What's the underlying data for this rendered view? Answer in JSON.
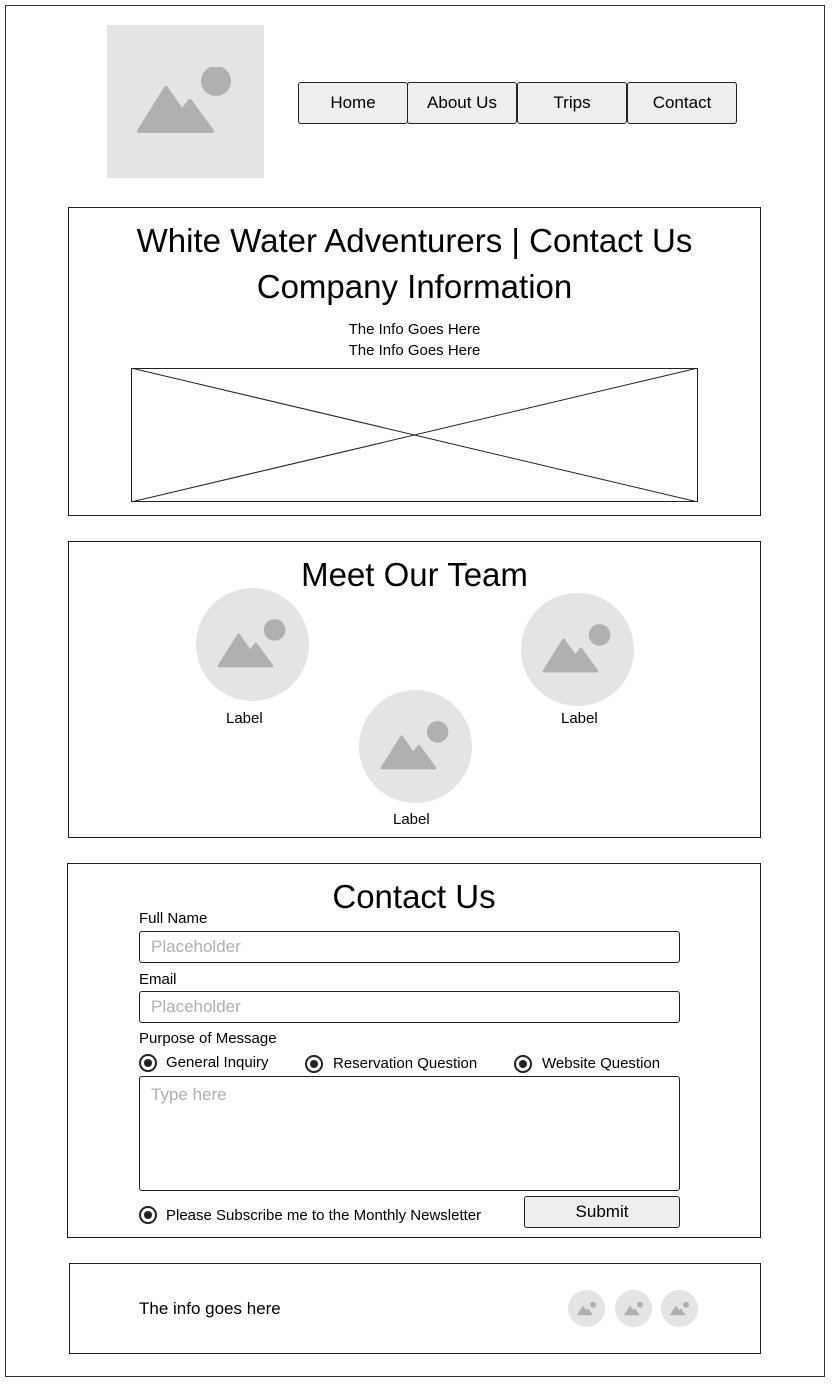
{
  "nav": {
    "items": [
      "Home",
      "About Us",
      "Trips",
      "Contact"
    ]
  },
  "company": {
    "title": "White Water Adventurers | Contact Us",
    "subtitle": "Company Information",
    "info_line_1": "The Info Goes Here",
    "info_line_2": "The Info Goes Here"
  },
  "team": {
    "title": "Meet Our Team",
    "members": [
      {
        "label": "Label"
      },
      {
        "label": "Label"
      },
      {
        "label": "Label"
      }
    ]
  },
  "contact": {
    "title": "Contact Us",
    "full_name_label": "Full Name",
    "full_name_placeholder": "Placeholder",
    "email_label": "Email",
    "email_placeholder": "Placeholder",
    "purpose_label": "Purpose of Message",
    "purpose_options": [
      "General Inquiry",
      "Reservation Question",
      "Website Question"
    ],
    "message_placeholder": "Type here",
    "newsletter_label": "Please Subscribe me to the Monthly Newsletter",
    "submit_label": "Submit"
  },
  "footer": {
    "text": "The info goes here"
  },
  "icons": {
    "logo": "image-placeholder-icon",
    "social": [
      "image-placeholder-icon",
      "image-placeholder-icon",
      "image-placeholder-icon"
    ]
  }
}
